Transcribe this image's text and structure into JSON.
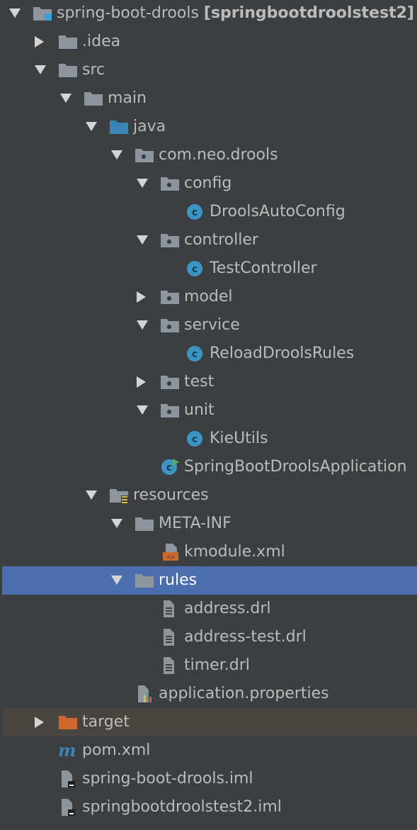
{
  "window": {
    "title": "Project tree"
  },
  "colors": {
    "background": "#3c3f41",
    "text": "#bbbbbb",
    "selected_row": "#4b6eaf",
    "excluded_row": "#49453e",
    "folder": "#8d969c",
    "source_folder": "#3a85b4",
    "class_icon": "#3b94c4",
    "excluded_folder": "#d0672e"
  },
  "tree": {
    "rows": [
      {
        "label": "spring-boot-drools",
        "suffix": "[springbootdroolstest2]",
        "icon": "module-folder-icon",
        "arrow": "down"
      },
      {
        "label": ".idea",
        "icon": "folder-icon",
        "arrow": "right"
      },
      {
        "label": "src",
        "icon": "folder-icon",
        "arrow": "down"
      },
      {
        "label": "main",
        "icon": "folder-icon",
        "arrow": "down"
      },
      {
        "label": "java",
        "icon": "source-folder-icon",
        "arrow": "down"
      },
      {
        "label": "com.neo.drools",
        "icon": "package-icon",
        "arrow": "down"
      },
      {
        "label": "config",
        "icon": "package-icon",
        "arrow": "down"
      },
      {
        "label": "DroolsAutoConfig",
        "icon": "class-icon",
        "arrow": "none"
      },
      {
        "label": "controller",
        "icon": "package-icon",
        "arrow": "down"
      },
      {
        "label": "TestController",
        "icon": "class-icon",
        "arrow": "none"
      },
      {
        "label": "model",
        "icon": "package-icon",
        "arrow": "right"
      },
      {
        "label": "service",
        "icon": "package-icon",
        "arrow": "down"
      },
      {
        "label": "ReloadDroolsRules",
        "icon": "class-icon",
        "arrow": "none"
      },
      {
        "label": "test",
        "icon": "package-icon",
        "arrow": "right"
      },
      {
        "label": "unit",
        "icon": "package-icon",
        "arrow": "down"
      },
      {
        "label": "KieUtils",
        "icon": "class-icon",
        "arrow": "none"
      },
      {
        "label": "SpringBootDroolsApplication",
        "icon": "runnable-class-icon",
        "arrow": "none"
      },
      {
        "label": "resources",
        "icon": "resources-folder-icon",
        "arrow": "down"
      },
      {
        "label": "META-INF",
        "icon": "folder-icon",
        "arrow": "down"
      },
      {
        "label": "kmodule.xml",
        "icon": "xml-file-icon",
        "arrow": "none"
      },
      {
        "label": "rules",
        "icon": "folder-icon",
        "arrow": "down",
        "selected": true
      },
      {
        "label": "address.drl",
        "icon": "text-file-icon",
        "arrow": "none"
      },
      {
        "label": "address-test.drl",
        "icon": "text-file-icon",
        "arrow": "none"
      },
      {
        "label": "timer.drl",
        "icon": "text-file-icon",
        "arrow": "none"
      },
      {
        "label": "application.properties",
        "icon": "properties-file-icon",
        "arrow": "none"
      },
      {
        "label": "target",
        "icon": "excluded-folder-icon",
        "arrow": "right",
        "excluded": true
      },
      {
        "label": "pom.xml",
        "icon": "maven-icon",
        "arrow": "none"
      },
      {
        "label": "spring-boot-drools.iml",
        "icon": "iml-file-icon",
        "arrow": "none"
      },
      {
        "label": "springbootdroolstest2.iml",
        "icon": "iml-file-icon",
        "arrow": "none"
      }
    ]
  }
}
